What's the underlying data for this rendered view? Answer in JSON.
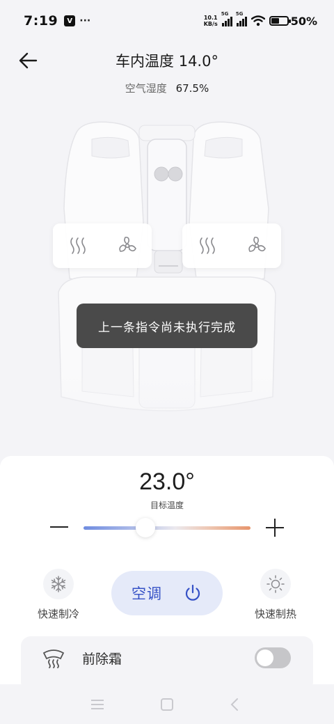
{
  "status_bar": {
    "time": "7:19",
    "app_badge": "V",
    "more": "···",
    "net_speed_value": "10.1",
    "net_speed_unit": "KB/s",
    "signal1_label": "5G",
    "signal2_label": "5G",
    "battery_percent": "50%",
    "battery_level": 0.5
  },
  "header": {
    "title": "车内温度 14.0°",
    "humidity_label": "空气湿度",
    "humidity_value": "67.5%"
  },
  "toast": {
    "message": "上一条指令尚未执行完成"
  },
  "climate": {
    "target_temp": "23.0°",
    "target_temp_label": "目标温度",
    "slider_fraction": 0.37,
    "quick_cool_label": "快速制冷",
    "ac_label": "空调",
    "quick_heat_label": "快速制热"
  },
  "defrost": {
    "label": "前除霜",
    "enabled": false
  },
  "icons": {
    "back": "arrow-left-icon",
    "seat_heat": "heat-waves-icon",
    "seat_fan": "fan-icon",
    "cool": "snowflake-icon",
    "heat": "sun-icon",
    "power": "power-icon",
    "defrost": "windshield-defrost-icon"
  },
  "colors": {
    "accent": "#3551c6",
    "ac_button_bg": "#e5eaf9",
    "toast_bg": "#4a4a4a",
    "slider_cold": "#6f8ce0",
    "slider_hot": "#e7956c"
  }
}
